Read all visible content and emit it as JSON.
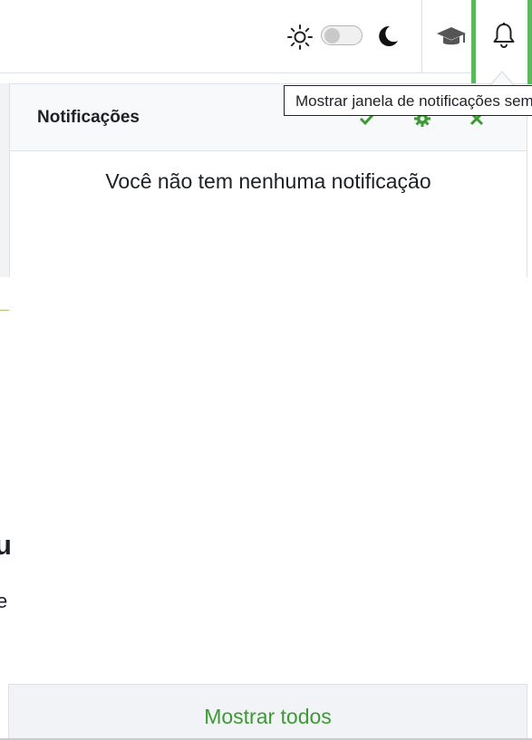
{
  "navbar": {
    "theme_light_icon": "sun-icon",
    "theme_toggle_state": "off",
    "theme_dark_icon": "moon-icon",
    "courses_icon": "graduation-cap-icon",
    "notifications_icon": "bell-icon",
    "accent_color": "#5cb85c"
  },
  "tooltip": {
    "text": "Mostrar janela de notificações sem as notificações novas"
  },
  "notifications": {
    "title": "Notificações",
    "actions": [
      "check-icon",
      "gear-icon",
      "close-icon"
    ],
    "empty_message": "Você não tem nenhuma notificação",
    "show_all_label": "Mostrar todos",
    "link_color": "#3b9b32"
  },
  "page_fragments": {
    "heading_fragment": "u",
    "text_fragment": "e"
  }
}
